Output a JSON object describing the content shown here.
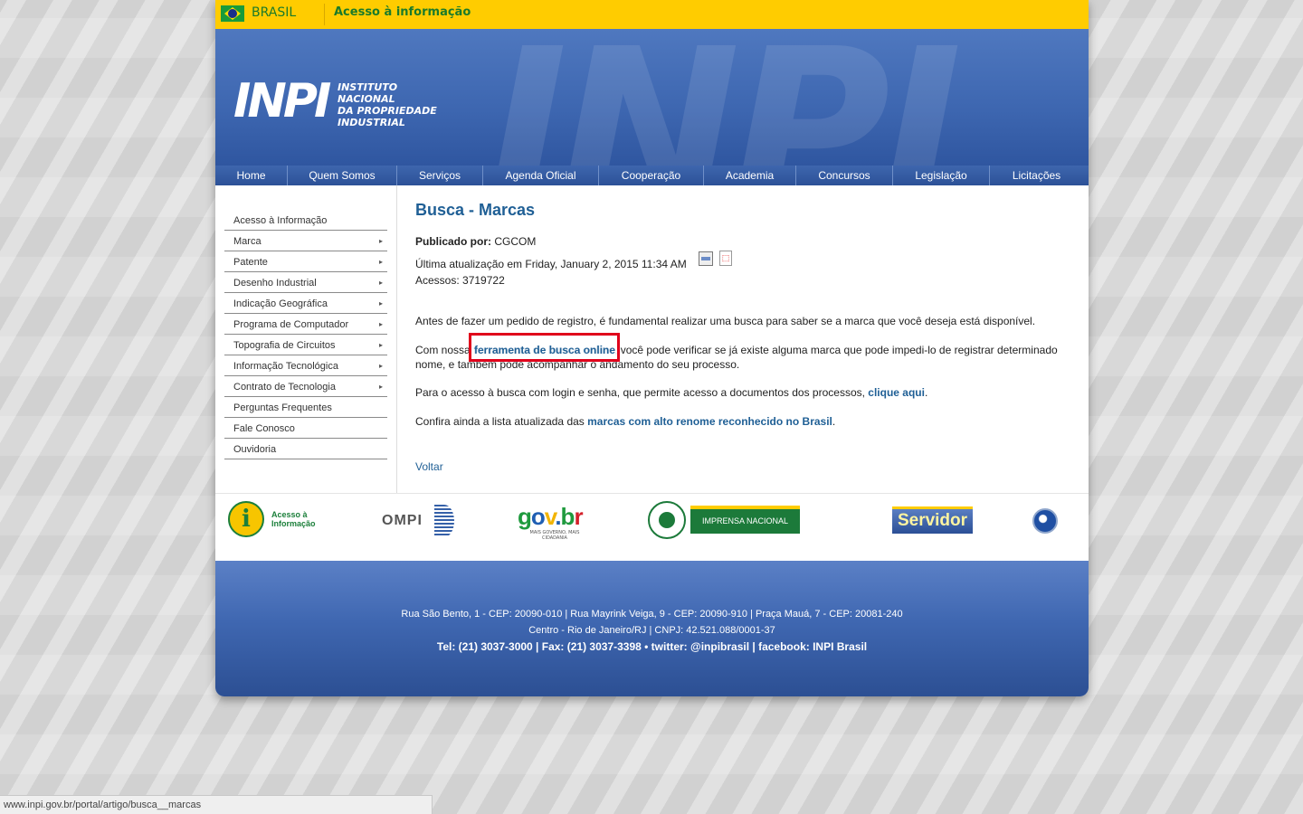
{
  "govbar": {
    "country": "BRASIL",
    "access_info": "Acesso à informação"
  },
  "header": {
    "logo_word": "INPI",
    "logo_lines": [
      "INSTITUTO",
      "NACIONAL",
      "DA PROPRIEDADE",
      "INDUSTRIAL"
    ]
  },
  "nav": [
    "Home",
    "Quem Somos",
    "Serviços",
    "Agenda Oficial",
    "Cooperação",
    "Academia",
    "Concursos",
    "Legislação",
    "Licitações"
  ],
  "sidebar": [
    {
      "label": "Acesso à Informação",
      "has_arrow": false
    },
    {
      "label": "Marca",
      "has_arrow": true
    },
    {
      "label": "Patente",
      "has_arrow": true
    },
    {
      "label": "Desenho Industrial",
      "has_arrow": true
    },
    {
      "label": "Indicação Geográfica",
      "has_arrow": true
    },
    {
      "label": "Programa de Computador",
      "has_arrow": true
    },
    {
      "label": "Topografia de Circuitos",
      "has_arrow": true
    },
    {
      "label": "Informação Tecnológica",
      "has_arrow": true
    },
    {
      "label": "Contrato de Tecnologia",
      "has_arrow": true
    },
    {
      "label": "Perguntas Frequentes",
      "has_arrow": false
    },
    {
      "label": "Fale Conosco",
      "has_arrow": false
    },
    {
      "label": "Ouvidoria",
      "has_arrow": false
    }
  ],
  "article": {
    "title": "Busca - Marcas",
    "published_label": "Publicado por:",
    "published_by": "CGCOM",
    "updated": "Última atualização em Friday, January 2, 2015 11:34 AM",
    "accesses": "Acessos: 3719722",
    "p1": "Antes de fazer um pedido de registro, é fundamental realizar uma busca para saber se a marca que você deseja está disponível.",
    "p2_before": "Com nossa ",
    "p2_link": "ferramenta de busca online",
    "p2_after": ", você pode verificar se já existe alguma marca que pode impedi-lo de registrar determinado nome, e também pode acompanhar o andamento do seu processo.",
    "p3_before": "Para o acesso à busca com login e senha, que permite acesso a documentos dos processos, ",
    "p3_link": "clique aqui",
    "p3_after": ".",
    "p4_before": "Confira ainda a lista atualizada das ",
    "p4_link": "marcas com alto renome reconhecido no Brasil",
    "p4_after": ".",
    "back": "Voltar"
  },
  "logos": {
    "acesso_line1": "Acesso à",
    "acesso_line2": "Informação",
    "ompi": "OMPI",
    "gov_letters": [
      "g",
      "o",
      "v",
      ".",
      "b",
      "r"
    ],
    "gov_colors": [
      "#1f9a3e",
      "#1f5fb3",
      "#f2b400",
      "#1f5fb3",
      "#1f9a3e",
      "#d4202a"
    ],
    "gov_sub": "MAIS GOVERNO, MAIS CIDADANIA",
    "imprensa": "IMPRENSA NACIONAL",
    "servidor": "Servidor"
  },
  "footer": {
    "line1": "Rua São Bento, 1 - CEP: 20090-010 | Rua Mayrink Veiga, 9 - CEP: 20090-910 | Praça Mauá, 7 - CEP: 20081-240",
    "line2": "Centro - Rio de Janeiro/RJ | CNPJ: 42.521.088/0001-37",
    "line3": "Tel: (21) 3037-3000 | Fax: (21) 3037-3398 • twitter: @inpibrasil | facebook: INPI Brasil"
  },
  "statusbar": {
    "url": "www.inpi.gov.br/portal/artigo/busca__marcas"
  }
}
